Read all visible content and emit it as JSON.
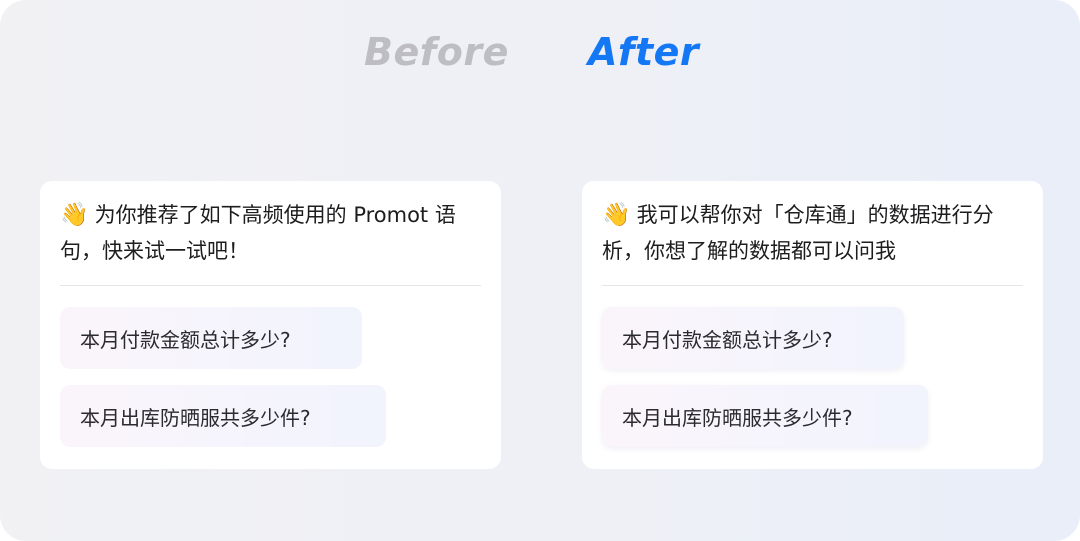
{
  "headings": {
    "before": "Before",
    "after": "After"
  },
  "before_card": {
    "emoji": "👋",
    "greeting": "为你推荐了如下高频使用的 Promot 语句，快来试一试吧！",
    "questions": [
      "本月付款金额总计多少?",
      "本月出库防晒服共多少件?"
    ]
  },
  "after_card": {
    "emoji": "👋",
    "greeting": "我可以帮你对「仓库通」的数据进行分析，你想了解的数据都可以问我",
    "questions": [
      "本月付款金额总计多少?",
      "本月出库防晒服共多少件?"
    ]
  }
}
